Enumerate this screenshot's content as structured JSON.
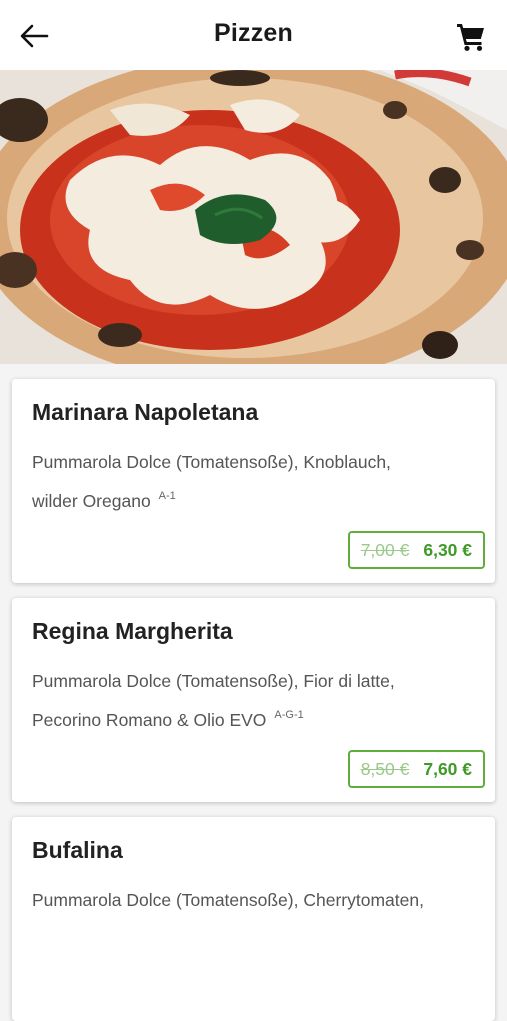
{
  "header": {
    "title": "Pizzen",
    "back_icon": "arrow-left-icon",
    "cart_icon": "shopping-cart-icon"
  },
  "hero": {
    "alt": "Pizza Margherita"
  },
  "colors": {
    "accent": "#3f9a27",
    "accent_border": "#5fae3c",
    "old_price": "#9bc98a"
  },
  "products": [
    {
      "name": "Marinara Napoletana",
      "description_line1": "Pummarola Dolce (Tomatensoße), Knoblauch,",
      "description_line2": "wilder Oregano",
      "allergens": "A-1",
      "old_price": "7,00 €",
      "price": "6,30 €"
    },
    {
      "name": "Regina Margherita",
      "description_line1": "Pummarola Dolce (Tomatensoße), Fior di latte,",
      "description_line2": "Pecorino Romano & Olio EVO",
      "allergens": "A-G-1",
      "old_price": "8,50 €",
      "price": "7,60 €"
    },
    {
      "name": "Bufalina",
      "description_line1": "Pummarola Dolce (Tomatensoße), Cherrytomaten,",
      "description_line2": "",
      "allergens": "",
      "old_price": "",
      "price": ""
    }
  ]
}
